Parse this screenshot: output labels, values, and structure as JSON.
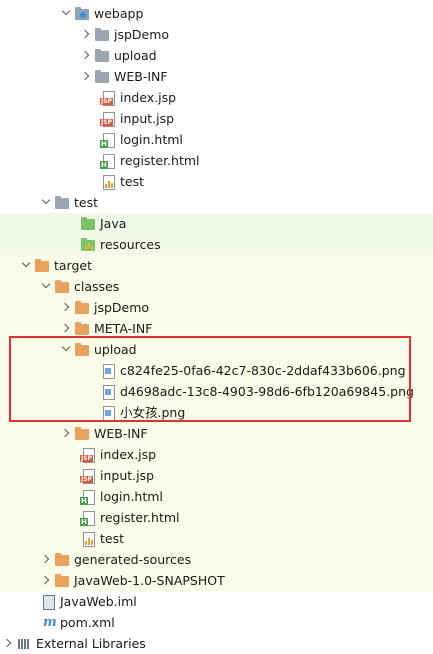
{
  "tree": {
    "webapp": "webapp",
    "jspDemo": "jspDemo",
    "upload": "upload",
    "webinf": "WEB-INF",
    "index_jsp": "index.jsp",
    "input_jsp": "input.jsp",
    "login_html": "login.html",
    "register_html": "register.html",
    "test": "test",
    "test_dir": "test",
    "java": "Java",
    "resources": "resources",
    "target": "target",
    "classes": "classes",
    "c_jspDemo": "jspDemo",
    "c_metainf": "META-INF",
    "c_upload": "upload",
    "upload_file1": "c824fe25-0fa6-42c7-830c-2ddaf433b606.png",
    "upload_file2": "d4698adc-13c8-4903-98d6-6fb120a69845.png",
    "upload_file3": "小女孩.png",
    "c_webinf": "WEB-INF",
    "c_index_jsp": "index.jsp",
    "c_input_jsp": "input.jsp",
    "c_login_html": "login.html",
    "c_register_html": "register.html",
    "c_test": "test",
    "generated_sources": "generated-sources",
    "snapshot": "JavaWeb-1.0-SNAPSHOT",
    "javaweb_iml": "JavaWeb.iml",
    "pom": "pom.xml",
    "external_libraries": "External Libraries"
  },
  "colors": {
    "highlight_box": "#e0322f",
    "test_tint": "#f2f9e9",
    "target_tint": "#fbfbea"
  }
}
